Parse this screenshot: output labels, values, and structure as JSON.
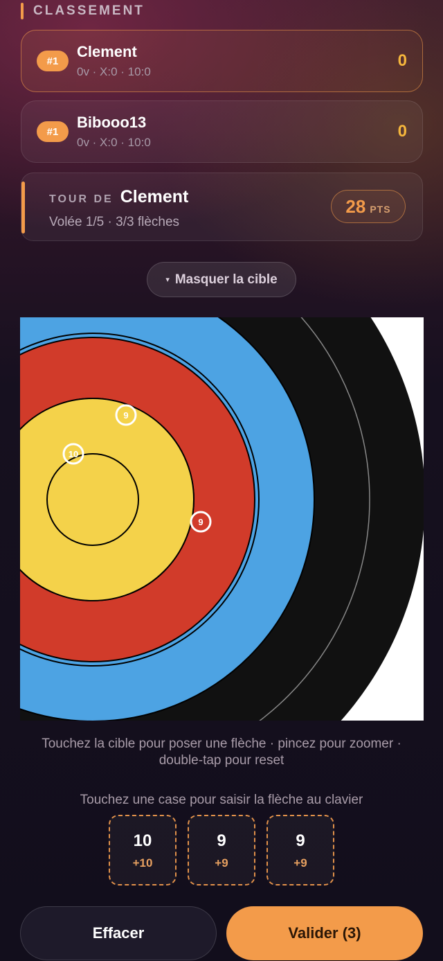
{
  "ranking": {
    "title": "CLASSEMENT",
    "players": [
      {
        "rank": "#1",
        "name": "Clement",
        "stats": "0v · X:0 · 10:0",
        "score": "0"
      },
      {
        "rank": "#1",
        "name": "Bibooo13",
        "stats": "0v · X:0 · 10:0",
        "score": "0"
      }
    ]
  },
  "turn": {
    "label": "TOUR DE",
    "player": "Clement",
    "detail": "Volée 1/5 · 3/3 flèches",
    "points_value": "28",
    "points_unit": "PTS"
  },
  "toggle": {
    "caret": "▾",
    "label": "Masquer la cible"
  },
  "target": {
    "colors": {
      "white": "#ffffff",
      "black": "#111111",
      "blue": "#4da3e3",
      "red": "#d13b2a",
      "yellow": "#f4d24a",
      "line": "#000000"
    },
    "arrows": [
      {
        "label": "9"
      },
      {
        "label": "10"
      },
      {
        "label": "9"
      }
    ]
  },
  "hints": {
    "line1": "Touchez la cible pour poser une flèche · pincez pour zoomer · double-tap pour reset",
    "line2": "Touchez une case pour saisir la flèche au clavier"
  },
  "arrow_scores": [
    {
      "value": "10",
      "points": "+10"
    },
    {
      "value": "9",
      "points": "+9"
    },
    {
      "value": "9",
      "points": "+9"
    }
  ],
  "actions": {
    "clear_label": "Effacer",
    "validate_label": "Valider (3)"
  },
  "colors": {
    "accent": "#f39b4a",
    "score_gold": "#f5b63c"
  }
}
